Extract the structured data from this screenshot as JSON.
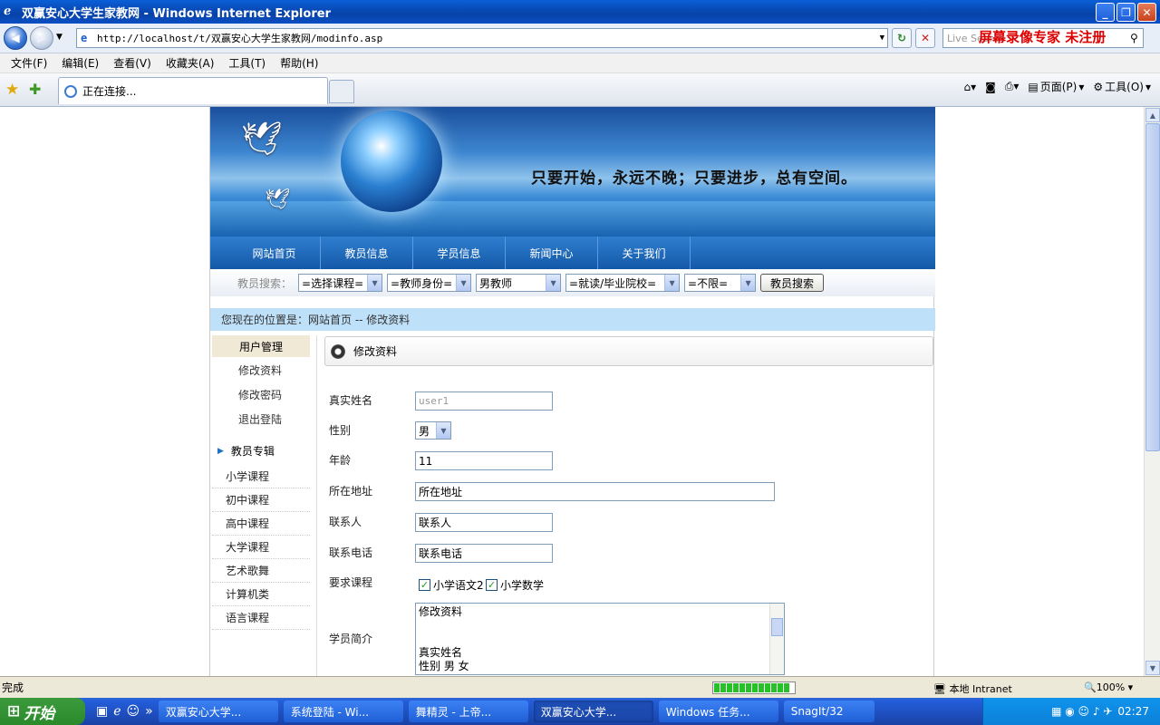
{
  "window": {
    "title": "双赢安心大学生家教网 - Windows Internet Explorer"
  },
  "address": {
    "url": "http://localhost/t/双赢安心大学生家教网/modinfo.asp",
    "search_placeholder": "Live Search"
  },
  "watermark": "屏幕录像专家 未注册",
  "menu": [
    "文件(F)",
    "编辑(E)",
    "查看(V)",
    "收藏夹(A)",
    "工具(T)",
    "帮助(H)"
  ],
  "tab": {
    "label": "正在连接..."
  },
  "commandbar": {
    "page": "页面(P)",
    "tools": "工具(O)"
  },
  "site": {
    "slogan": "只要开始，永远不晚；只要进步，总有空间。",
    "nav": [
      "网站首页",
      "教员信息",
      "学员信息",
      "新闻中心",
      "关于我们"
    ],
    "search": {
      "label": "教员搜索：",
      "course": "=选择课程=",
      "identity": "=教师身份=",
      "gender": "男教师",
      "school": "=就读/毕业院校=",
      "limit": "=不限=",
      "button": "教员搜索"
    },
    "breadcrumb": "您现在的位置是：网站首页 -- 修改资料",
    "sidebar": {
      "header": "用户管理",
      "items": [
        "修改资料",
        "修改密码",
        "退出登陆"
      ],
      "section": "教员专辑",
      "courses": [
        "小学课程",
        "初中课程",
        "高中课程",
        "大学课程",
        "艺术歌舞",
        "计算机类",
        "语言课程"
      ]
    },
    "panel_title": "修改资料",
    "form": {
      "name_label": "真实姓名",
      "name_value": "user1",
      "gender_label": "性别",
      "gender_value": "男",
      "age_label": "年龄",
      "age_value": "11",
      "address_label": "所在地址",
      "address_value": "所在地址",
      "contact_label": "联系人",
      "contact_value": "联系人",
      "phone_label": "联系电话",
      "phone_value": "联系电话",
      "courses_label": "要求课程",
      "course1": "小学语文2",
      "course2": "小学数学",
      "intro_label": "学员简介",
      "intro_lines": [
        "修改资料",
        "",
        "",
        "真实姓名",
        "性别  男  女"
      ]
    }
  },
  "statusbar": {
    "text": "完成",
    "zone": "本地 Intranet",
    "zoom": "100%"
  },
  "taskbar": {
    "start": "开始",
    "tasks": [
      "双赢安心大学...",
      "系统登陆 - Wi...",
      "舞精灵 - 上帝...",
      "双赢安心大学...",
      "Windows 任务...",
      "SnagIt/32"
    ],
    "clock": "02:27"
  }
}
